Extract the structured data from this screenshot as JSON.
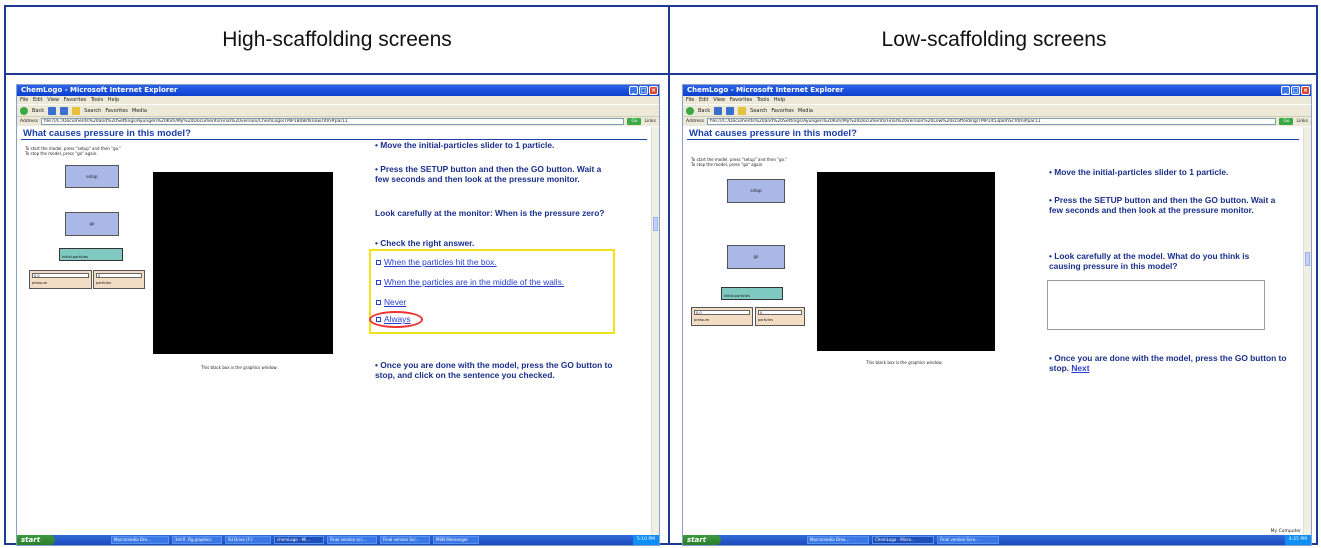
{
  "headers": {
    "left": "High-scaffolding screens",
    "right": "Low-scaffolding screens"
  },
  "browser": {
    "title": "ChemLogo - Microsoft Internet Explorer",
    "menu": "File  Edit  View  Favorites  Tools  Help",
    "toolbar_back": "Back",
    "toolbar_search": "Search",
    "toolbar_favorites": "Favorites",
    "toolbar_media": "Media",
    "address_label": "Address",
    "go_label": "Go",
    "links_label": "Links"
  },
  "high": {
    "address": "file:///C:/Documents%20and%20Settings/Ayungen%20Kim/My%20Documents/Final%20version/ChemLogo/TMP1808sfknow.htm#par11",
    "page_title": "What causes pressure in this model?",
    "model_hint": "To start the model, press \"setup\" and then \"go.\"\nTo stop the model, press \"go\" again.",
    "setup_label": "setup",
    "go_label": "go",
    "slider_label": "initial-particles",
    "pressure_value": "0.0",
    "pressure_label": "pressure",
    "particles_value": "0",
    "particles_label": "particles",
    "graphics_caption": "This black box is the graphics window.",
    "instr1": "• Move the initial-particles slider to 1 particle.",
    "instr2": "• Press the SETUP button and then the GO button. Wait a few seconds and then look at the pressure monitor.",
    "instr3": "Look carefully at the monitor: When is the pressure zero?",
    "instr4": "• Check the right answer.",
    "choices": [
      "When the particles hit the box.",
      "When the particles are in the middle of the walls.",
      "Never",
      "Always"
    ],
    "instr5": "• Once you are done with the model, press the GO button to stop, and click on the sentence you checked.",
    "taskbar": [
      "Macromedia Dre...",
      "3rd fl, fig.graphics",
      "ISI Drive (F:)",
      "chemLogo - Mi...",
      "Final version scr...",
      "Final version Scr...",
      "MSN Messenger"
    ],
    "clock": "5:10 PM"
  },
  "low": {
    "address": "file:///C:/Documents%20and%20Settings/Ayungen%20Kim/My%20Documents/Final%20version%20Low%20scaffolding/TMP1453pkmSr.htm#par11",
    "page_title": "What causes pressure in this model?",
    "model_hint": "To start the model, press \"setup\" and then \"go.\"\nTo stop the model, press \"go\" again.",
    "setup_label": "setup",
    "go_label": "go",
    "slider_label": "initial-particles",
    "pressure_value": "0.0",
    "pressure_label": "pressure",
    "particles_value": "0",
    "particles_label": "particles",
    "graphics_caption": "This black box is the graphics window.",
    "instr1": "• Move the initial-particles slider to 1 particle.",
    "instr2": "• Press the SETUP button and then the GO button. Wait a few seconds and then look at the pressure monitor.",
    "instr3": "• Look carefully at the model. What do you think is causing pressure in this model?",
    "instr4": "• Once you are done with the model, press the GO button to stop.",
    "next_link": "Next",
    "status": "My Computer",
    "taskbar": [
      "Macromedia Drea...",
      "ChemLogo - Micro...",
      "Final version Scre..."
    ],
    "clock": "4:25 PM"
  }
}
